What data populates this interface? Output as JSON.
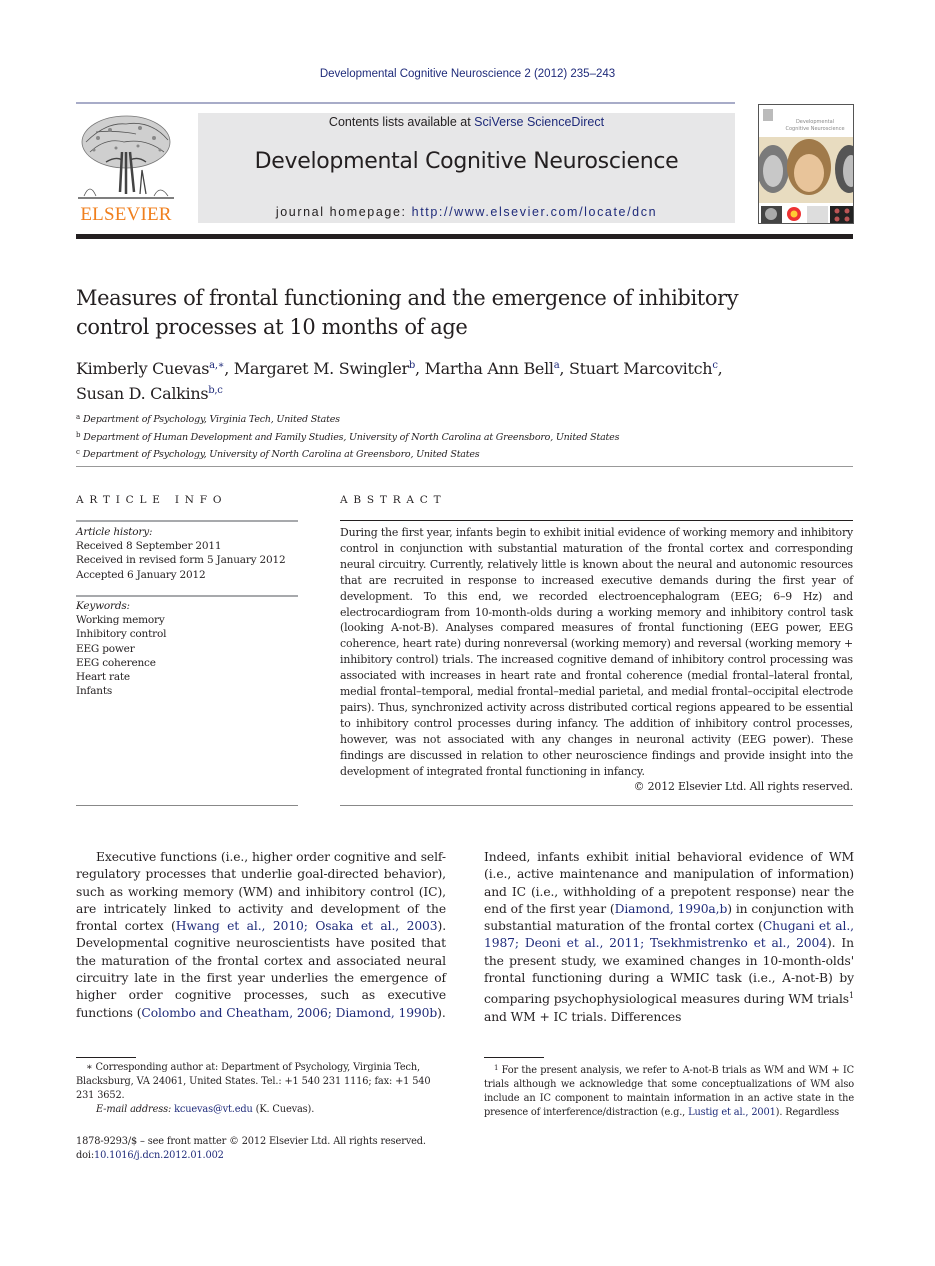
{
  "running_head": "Developmental Cognitive Neuroscience 2 (2012) 235–243",
  "masthead": {
    "publisher_logo_text": "ELSEVIER",
    "contents_prefix": "Contents lists available at ",
    "contents_link": "SciVerse ScienceDirect",
    "journal_title": "Developmental Cognitive Neuroscience",
    "homepage_prefix": "journal homepage: ",
    "homepage_url": "http://www.elsevier.com/locate/dcn",
    "cover_title": "Developmental Cognitive Neuroscience"
  },
  "colors": {
    "link": "#1f2b7a",
    "elsevier_orange": "#f07f1d",
    "masthead_bg": "#e7e7e8",
    "text": "#231f20"
  },
  "article": {
    "title_line1": "Measures of frontal functioning and the emergence of inhibitory",
    "title_line2": "control processes at 10 months of age",
    "authors": [
      {
        "name": "Kimberly Cuevas",
        "sup": "a,∗",
        "sep": ", "
      },
      {
        "name": "Margaret M. Swingler",
        "sup": "b",
        "sep": ", "
      },
      {
        "name": "Martha Ann Bell",
        "sup": "a",
        "sep": ", "
      },
      {
        "name": "Stuart Marcovitch",
        "sup": "c",
        "sep": ","
      },
      {
        "name": "Susan D. Calkins",
        "sup": "b,c",
        "sep": ""
      }
    ],
    "affiliations": [
      {
        "key": "a",
        "text": "Department of Psychology, Virginia Tech, United States"
      },
      {
        "key": "b",
        "text": "Department of Human Development and Family Studies, University of North Carolina at Greensboro, United States"
      },
      {
        "key": "c",
        "text": "Department of Psychology, University of North Carolina at Greensboro, United States"
      }
    ]
  },
  "article_info": {
    "heading": "ARTICLE INFO",
    "history_label": "Article history:",
    "history": [
      "Received 8 September 2011",
      "Received in revised form 5 January 2012",
      "Accepted 6 January 2012"
    ],
    "keywords_label": "Keywords:",
    "keywords": [
      "Working memory",
      "Inhibitory control",
      "EEG power",
      "EEG coherence",
      "Heart rate",
      "Infants"
    ]
  },
  "abstract": {
    "heading": "ABSTRACT",
    "text": "During the first year, infants begin to exhibit initial evidence of working memory and inhibitory control in conjunction with substantial maturation of the frontal cortex and corresponding neural circuitry. Currently, relatively little is known about the neural and autonomic resources that are recruited in response to increased executive demands during the first year of development. To this end, we recorded electroencephalogram (EEG; 6–9 Hz) and electrocardiogram from 10-month-olds during a working memory and inhibitory control task (looking A-not-B). Analyses compared measures of frontal functioning (EEG power, EEG coherence, heart rate) during nonreversal (working memory) and reversal (working memory + inhibitory control) trials. The increased cognitive demand of inhibitory control processing was associated with increases in heart rate and frontal coherence (medial frontal–lateral frontal, medial frontal–temporal, medial frontal–medial parietal, and medial frontal–occipital electrode pairs). Thus, synchronized activity across distributed cortical regions appeared to be essential to inhibitory control processes during infancy. The addition of inhibitory control processes, however, was not associated with any changes in neuronal activity (EEG power). These findings are discussed in relation to other neuroscience findings and provide insight into the development of integrated frontal functioning in infancy.",
    "copyright": "© 2012 Elsevier Ltd. All rights reserved."
  },
  "body": {
    "left": [
      {
        "t": "Executive functions (i.e., higher order cognitive and self-regulatory processes that underlie goal-directed behavior), such as working memory (WM) and inhibitory control (IC), are intricately linked to activity and development of the frontal cortex (",
        "link": false
      },
      {
        "t": "Hwang et al., 2010; Osaka et al., 2003",
        "link": true
      },
      {
        "t": "). Developmental cognitive neuroscientists have posited that the maturation of the frontal cortex and associated neural circuitry late in the first year underlies the emergence of higher order cognitive processes, such as executive functions (",
        "link": false
      },
      {
        "t": "Colombo and Cheatham, 2006; Diamond, 1990b",
        "link": true
      },
      {
        "t": ").",
        "link": false
      }
    ],
    "right": [
      {
        "t": "Indeed, infants exhibit initial behavioral evidence of WM (i.e., active maintenance and manipulation of information) and IC (i.e., withholding of a prepotent response) near the end of the first year (",
        "link": false
      },
      {
        "t": "Diamond, 1990a,b",
        "link": true
      },
      {
        "t": ") in conjunction with substantial maturation of the frontal cortex (",
        "link": false
      },
      {
        "t": "Chugani et al., 1987; Deoni et al., 2011; Tsekhmistrenko et al., 2004",
        "link": true
      },
      {
        "t": "). In the present study, we examined changes in 10-month-olds' frontal functioning during a WMIC task (i.e., A-not-B) by comparing psychophysiological measures during WM trials",
        "link": false
      },
      {
        "t": "1",
        "sup": true
      },
      {
        "t": " and WM + IC trials. Differences",
        "link": false
      }
    ]
  },
  "footnotes": {
    "corresponding": "∗  Corresponding author at: Department of Psychology, Virginia Tech, Blacksburg, VA 24061, United States. Tel.: +1 540 231 1116; fax: +1 540 231 3652.",
    "email_label": "E-mail address: ",
    "email": "kcuevas@vt.edu",
    "email_suffix": " (K. Cuevas).",
    "front_matter": "1878-9293/$ – see front matter © 2012 Elsevier Ltd. All rights reserved.",
    "doi_prefix": "doi:",
    "doi": "10.1016/j.dcn.2012.01.002",
    "fn1_mark": "1",
    "fn1_text": " For the present analysis, we refer to A-not-B trials as WM and WM + IC trials although we acknowledge that some conceptualizations of WM also include an IC component to maintain information in an active state in the presence of interference/distraction (e.g., ",
    "fn1_link": "Lustig et al., 2001",
    "fn1_after": "). Regardless"
  }
}
